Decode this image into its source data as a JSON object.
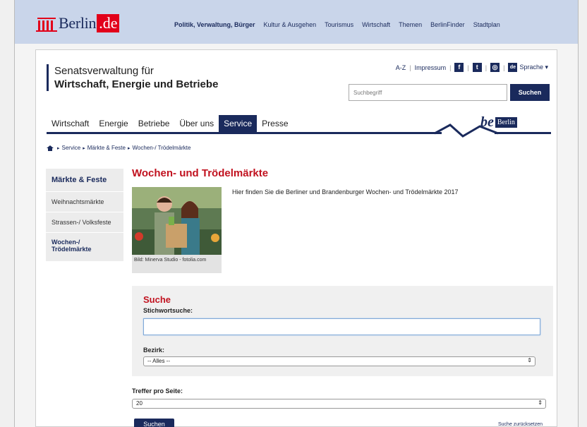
{
  "portal": {
    "logo_text": "Berlin",
    "logo_tld": ".de",
    "nav": [
      "Politik, Verwaltung, Bürger",
      "Kultur & Ausgehen",
      "Tourismus",
      "Wirtschaft",
      "Themen",
      "BerlinFinder",
      "Stadtplan"
    ]
  },
  "dept": {
    "line1": "Senatsverwaltung für",
    "line2": "Wirtschaft, Energie und Betriebe"
  },
  "utility": {
    "az": "A-Z",
    "impressum": "Impressum",
    "facebook": "f",
    "twitter": "t",
    "instagram": "◎",
    "lang_badge": "de",
    "sprache": "Sprache ▾"
  },
  "search": {
    "placeholder": "Suchbegriff",
    "button": "Suchen"
  },
  "mainnav": [
    "Wirtschaft",
    "Energie",
    "Betriebe",
    "Über uns",
    "Service",
    "Presse"
  ],
  "brand": {
    "be": "be",
    "berlin": "Berlin"
  },
  "breadcrumb": [
    "Service",
    "Märkte & Feste",
    "Wochen-/ Trödelmärkte"
  ],
  "sidenav": {
    "head": "Märkte & Feste",
    "items": [
      "Weihnachtsmärkte",
      "Strassen-/ Volksfeste"
    ],
    "active_l1": "Wochen-/",
    "active_l2": "Trödelmärkte"
  },
  "content": {
    "title": "Wochen- und Trödelmärkte",
    "caption": "Bild: Minerva Studio - fotolia.com",
    "intro": "Hier finden Sie die Berliner und Brandenburger Wochen- und Trödelmärkte 2017"
  },
  "form": {
    "title": "Suche",
    "keyword_label": "Stichwortsuche:",
    "keyword_value": "",
    "bezirk_label": "Bezirk:",
    "bezirk_value": "-- Alles --",
    "treffer_label": "Treffer pro Seite:",
    "treffer_value": "20",
    "submit": "Suchen",
    "reset": "Suche zurücksetzen"
  },
  "colors": {
    "navy": "#1a2a5c",
    "red": "#c1121f",
    "portal_bg": "#c9d5ea"
  }
}
